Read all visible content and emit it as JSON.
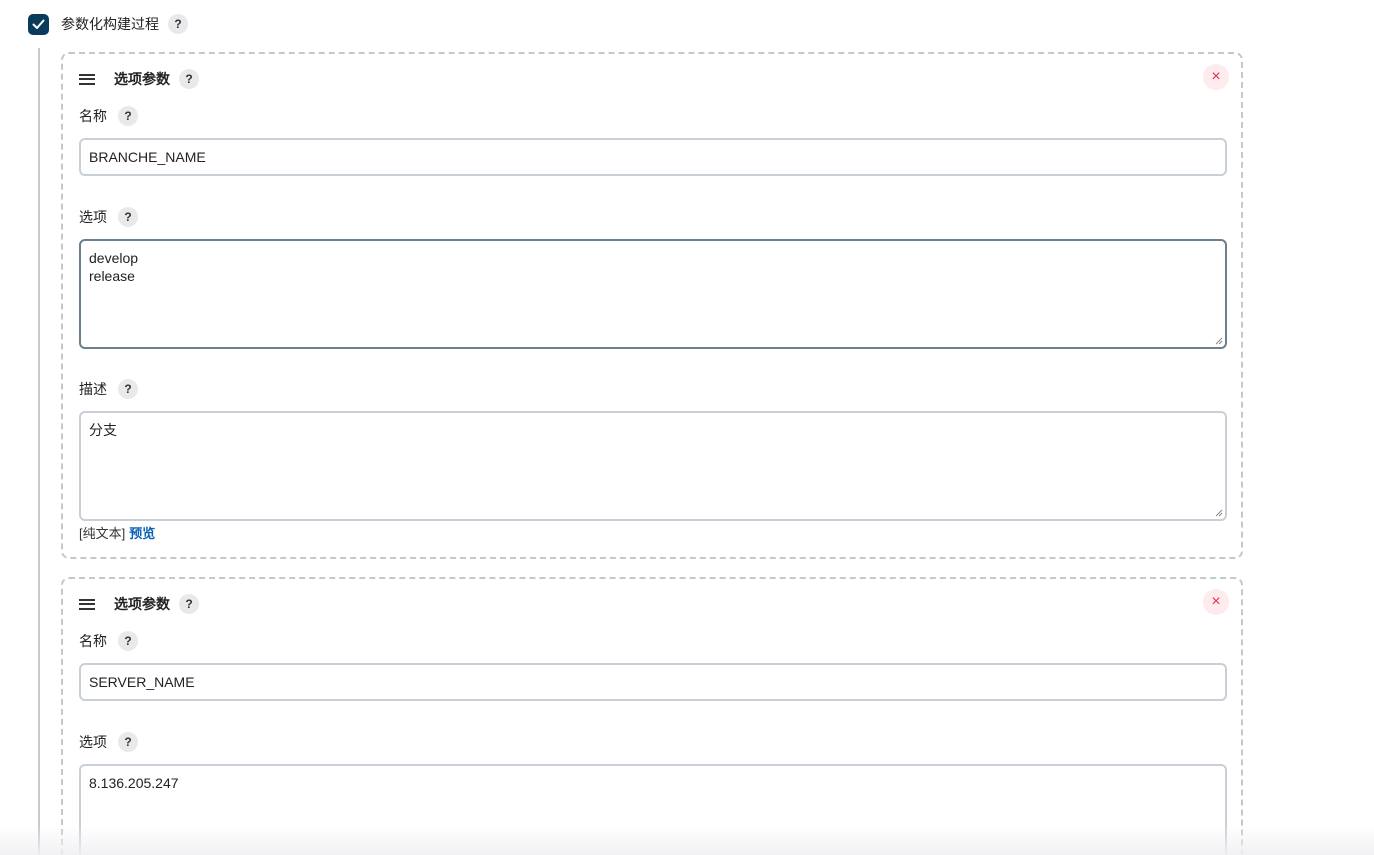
{
  "top": {
    "label": "参数化构建过程",
    "help": "?"
  },
  "cards": [
    {
      "title": "选项参数",
      "help": "?",
      "close": "×",
      "name_label": "名称",
      "name_value": "BRANCHE_NAME",
      "choices_label": "选项",
      "choices_value": "develop\nrelease",
      "desc_label": "描述",
      "desc_value": "分支",
      "plain_text": "[纯文本]",
      "preview": "预览"
    },
    {
      "title": "选项参数",
      "help": "?",
      "close": "×",
      "name_label": "名称",
      "name_value": "SERVER_NAME",
      "choices_label": "选项",
      "choices_value": "8.136.205.247"
    }
  ],
  "colors": {
    "checkbox": "#0b3b5c",
    "link": "#0b63b5",
    "close": "#e2314d"
  }
}
